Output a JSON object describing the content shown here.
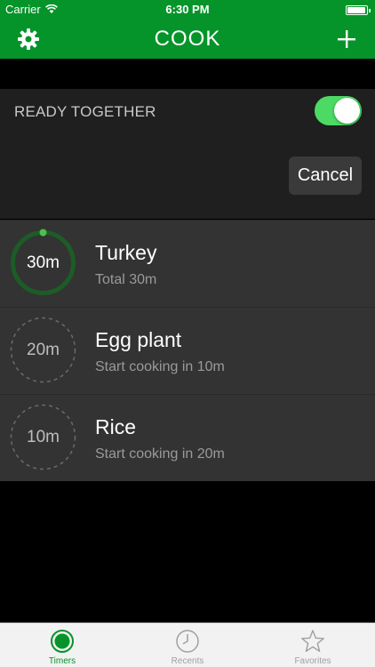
{
  "status_bar": {
    "carrier": "Carrier",
    "time": "6:30 PM"
  },
  "nav": {
    "title": "COOK"
  },
  "ready_together": {
    "label": "READY TOGETHER",
    "enabled": true,
    "cancel_label": "Cancel"
  },
  "timers": [
    {
      "ring_label": "30m",
      "name": "Turkey",
      "subtitle": "Total 30m",
      "active": true
    },
    {
      "ring_label": "20m",
      "name": "Egg plant",
      "subtitle": "Start cooking in 10m",
      "active": false
    },
    {
      "ring_label": "10m",
      "name": "Rice",
      "subtitle": "Start cooking in 20m",
      "active": false
    }
  ],
  "tabs": [
    {
      "label": "Timers",
      "icon": "timer-icon",
      "active": true
    },
    {
      "label": "Recents",
      "icon": "clock-icon",
      "active": false
    },
    {
      "label": "Favorites",
      "icon": "star-icon",
      "active": false
    }
  ],
  "colors": {
    "brand_green": "#05942a",
    "toggle_green": "#4cd964",
    "ring_green": "#4bc04b"
  }
}
